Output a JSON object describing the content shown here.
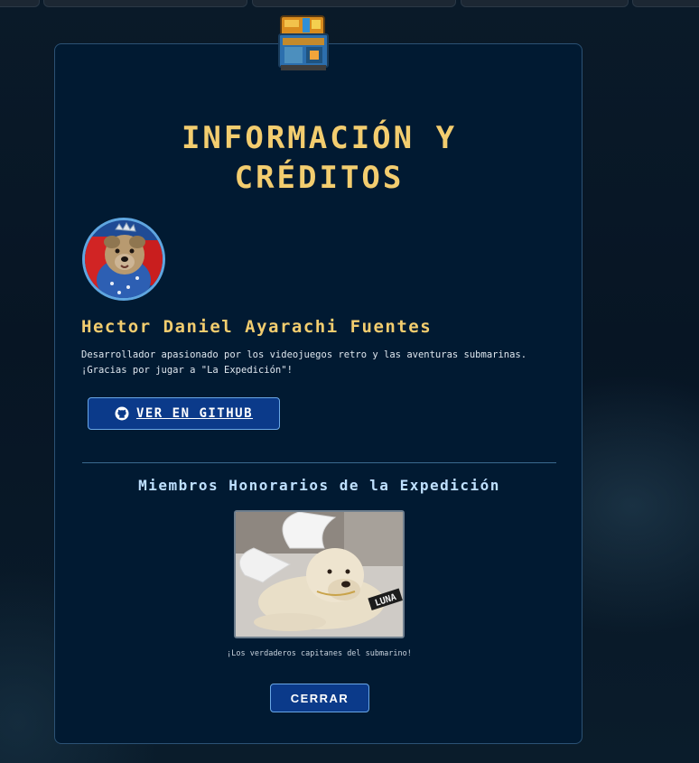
{
  "modal": {
    "title_line1": "Información y",
    "title_line2": "Créditos",
    "developer": {
      "name": "Hector Daniel Ayarachi Fuentes",
      "description": "Desarrollador apasionado por los videojuegos retro y las aventuras submarinas. ¡Gracias por jugar a \"La Expedición\"!",
      "github_label": "VER EN GITHUB"
    },
    "honorary": {
      "title": "Miembros Honorarios de la Expedición",
      "photo_tag": "LUNA",
      "caption": "¡Los verdaderos capitanes del submarino!"
    },
    "close_label": "CERRAR"
  },
  "colors": {
    "accent_gold": "#f3cd6f",
    "button_blue": "#0b3a8a",
    "panel_bg": "#011a32",
    "honor_title": "#bfe0ff"
  },
  "icons": {
    "header": "treasure-chest-icon",
    "github": "github-icon"
  }
}
